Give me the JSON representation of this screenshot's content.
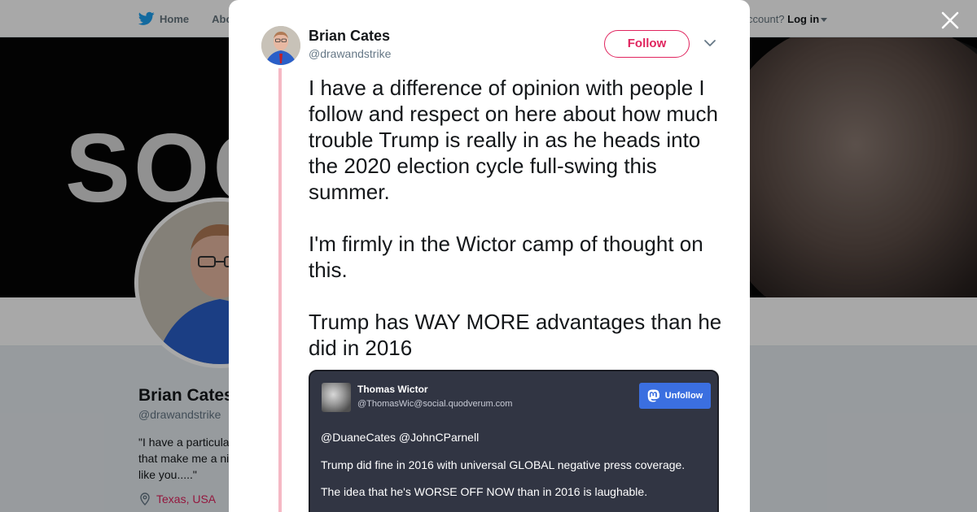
{
  "topbar": {
    "home_label": "Home",
    "about_label": "Abo",
    "account_prompt": "ccount?",
    "login_label": "Log in"
  },
  "banner": {
    "word": "SOC"
  },
  "profile": {
    "name": "Brian Cates",
    "handle": "@drawandstrike",
    "bio": "\"I have a particula that make me a ni like you.....\"",
    "location": "Texas, USA"
  },
  "tweet": {
    "author_name": "Brian Cates",
    "author_handle": "@drawandstrike",
    "follow_label": "Follow",
    "paragraphs": [
      "I have a difference of opinion with people I follow and respect on here about how much trouble Trump is really in as he heads into the 2020 election cycle full-swing this summer.",
      "I'm firmly in the Wictor camp of thought on this.",
      "Trump has WAY MORE advantages than he did in 2016"
    ]
  },
  "embedded": {
    "author_name": "Thomas Wictor",
    "author_handle": "@ThomasWic@social.quodverum.com",
    "unfollow_label": "Unfollow",
    "lines": [
      "@DuaneCates @JohnCParnell",
      "Trump did fine in 2016 with universal GLOBAL negative press coverage.",
      "The idea that he's WORSE OFF NOW than in 2016 is laughable."
    ]
  },
  "colors": {
    "accent": "#e0245e",
    "thread_line": "#f5b8c4",
    "embed_bg": "#313543",
    "unfollow_bg": "#3b6fe0"
  }
}
